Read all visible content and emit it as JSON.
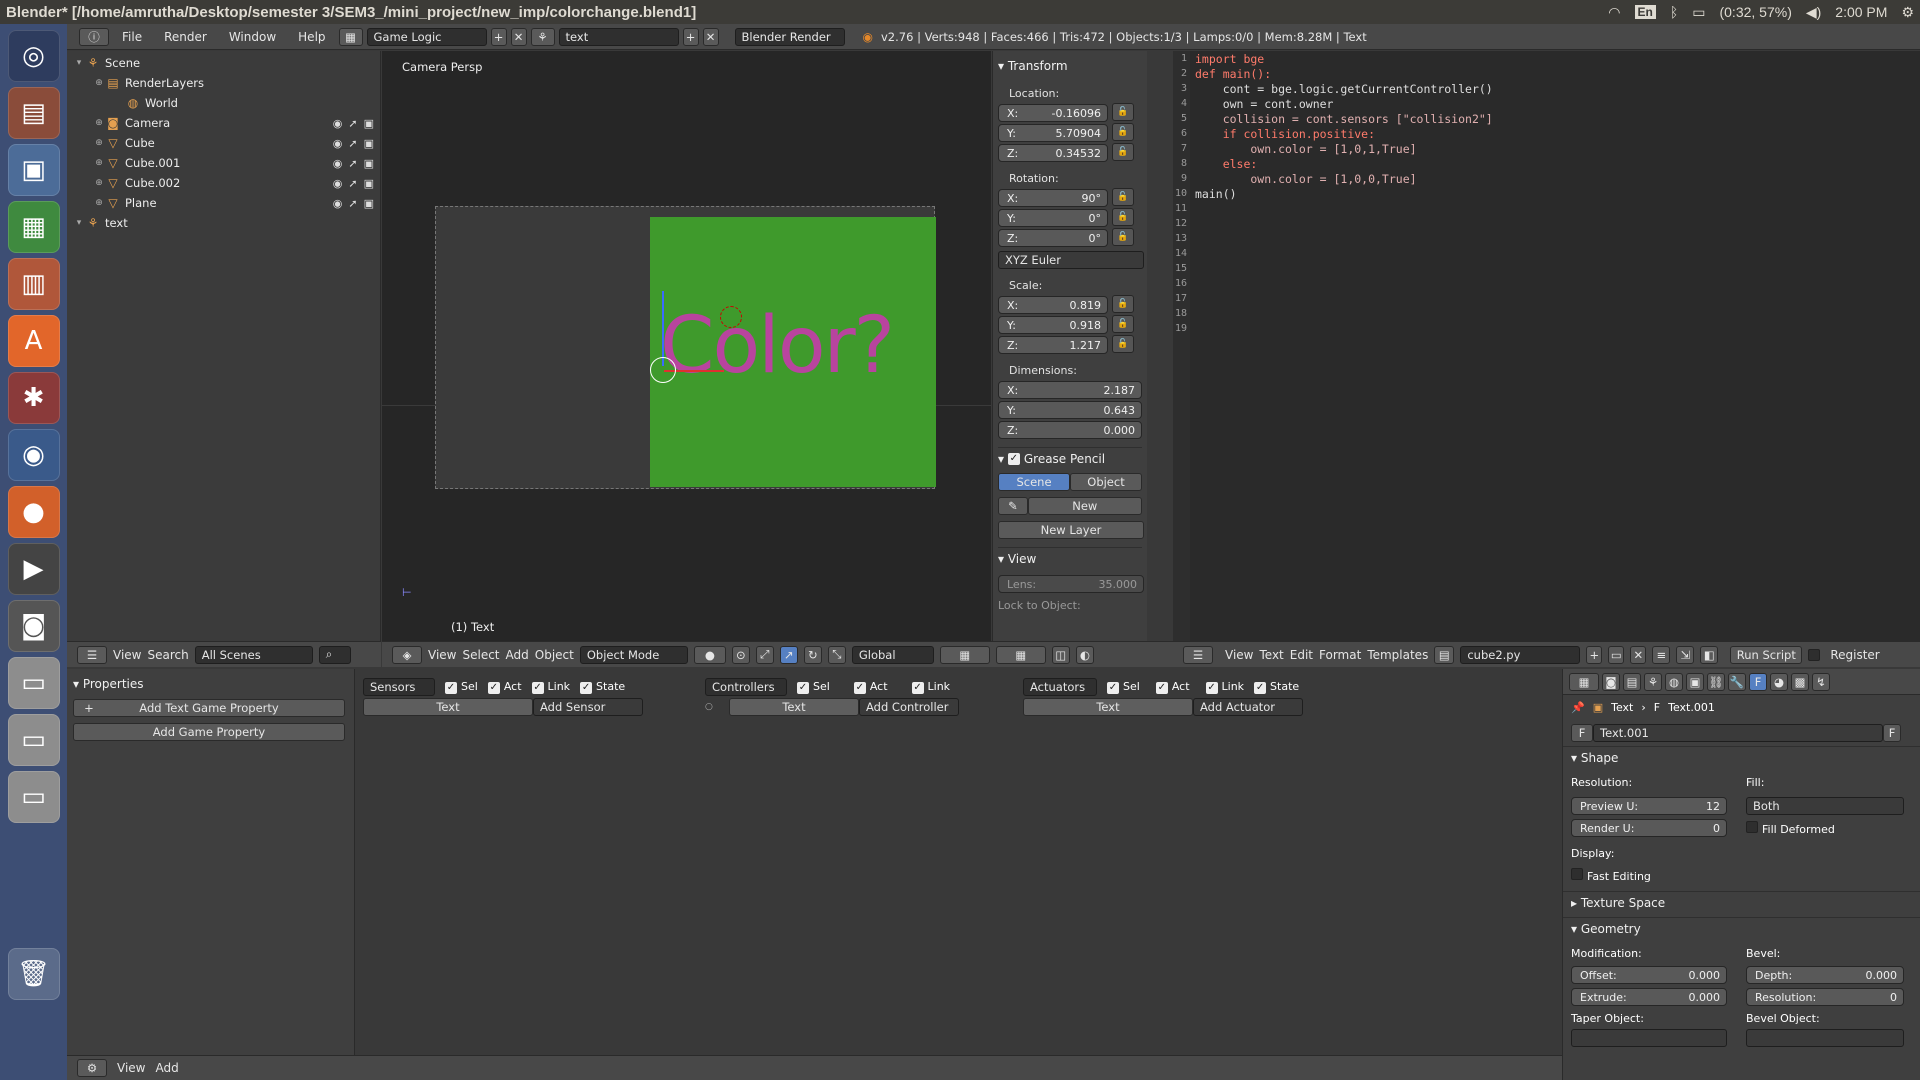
{
  "window": {
    "title": "Blender* [/home/amrutha/Desktop/semester 3/SEM3_/mini_project/new_imp/colorchange.blend1]"
  },
  "tray": {
    "lang": "En",
    "battery": "(0:32, 57%)",
    "time": "2:00 PM"
  },
  "menubar": {
    "items": [
      "File",
      "Render",
      "Window",
      "Help"
    ],
    "screen": "Game Logic",
    "scene": "text",
    "engine": "Blender Render",
    "stats": "v2.76 | Verts:948 | Faces:466 | Tris:472 | Objects:1/3 | Lamps:0/0 | Mem:8.28M | Text"
  },
  "outliner": {
    "items": [
      {
        "label": "Scene",
        "icon": "scene-icon"
      },
      {
        "label": "RenderLayers",
        "icon": "renderlayers-icon"
      },
      {
        "label": "World",
        "icon": "world-icon"
      },
      {
        "label": "Camera",
        "icon": "camera-icon"
      },
      {
        "label": "Cube",
        "icon": "mesh-icon"
      },
      {
        "label": "Cube.001",
        "icon": "mesh-icon"
      },
      {
        "label": "Cube.002",
        "icon": "mesh-icon"
      },
      {
        "label": "Plane",
        "icon": "mesh-icon"
      },
      {
        "label": "text",
        "icon": "scene-icon"
      }
    ],
    "header": {
      "view": "View",
      "search": "Search",
      "filter": "All Scenes"
    }
  },
  "viewport": {
    "label": "Camera Persp",
    "object_label": "(1) Text",
    "text_object": "Color?",
    "header": {
      "view": "View",
      "select": "Select",
      "add": "Add",
      "object": "Object",
      "mode": "Object Mode",
      "orientation": "Global"
    }
  },
  "transform": {
    "title": "Transform",
    "location_label": "Location:",
    "location": [
      "-0.16096",
      "5.70904",
      "0.34532"
    ],
    "rotation_label": "Rotation:",
    "rotation": [
      "90°",
      "0°",
      "0°"
    ],
    "rotation_mode": "XYZ Euler",
    "scale_label": "Scale:",
    "scale": [
      "0.819",
      "0.918",
      "1.217"
    ],
    "dimensions_label": "Dimensions:",
    "dimensions": [
      "2.187",
      "0.643",
      "0.000"
    ],
    "axes": [
      "X:",
      "Y:",
      "Z:"
    ]
  },
  "grease_pencil": {
    "title": "Grease Pencil",
    "scene": "Scene",
    "object": "Object",
    "new": "New",
    "new_layer": "New Layer"
  },
  "view_panel": {
    "title": "View",
    "lens_label": "Lens:",
    "lens": "35.000",
    "lock_label": "Lock to Object:"
  },
  "text_editor": {
    "lines": [
      "import bge",
      "",
      "",
      "def main():",
      "",
      "    cont = bge.logic.getCurrentController()",
      "    own = cont.owner",
      "",
      "    collision = cont.sensors [\"collision2\"]",
      "",
      "",
      "    if collision.positive:",
      "        own.color = [1,0,1,True]",
      "    else:",
      "        own.color = [1,0,0,True]",
      "",
      "",
      "main()",
      ""
    ],
    "header": {
      "view": "View",
      "text": "Text",
      "edit": "Edit",
      "format": "Format",
      "templates": "Templates",
      "file": "cube2.py",
      "run": "Run Script",
      "register": "Register"
    }
  },
  "logic": {
    "properties_title": "Properties",
    "add_text_prop": "Add Text Game Property",
    "add_prop": "Add Game Property",
    "sensors": "Sensors",
    "controllers": "Controllers",
    "actuators": "Actuators",
    "sel": "Sel",
    "act": "Act",
    "link": "Link",
    "state": "State",
    "object_name": "Text",
    "add_sensor": "Add Sensor",
    "add_controller": "Add Controller",
    "add_actuator": "Add Actuator",
    "bottom": {
      "view": "View",
      "add": "Add"
    }
  },
  "props": {
    "breadcrumb_obj": "Text",
    "breadcrumb_data": "Text.001",
    "datablock": "Text.001",
    "f_btn": "F",
    "shape_title": "Shape",
    "resolution_label": "Resolution:",
    "preview_u_label": "Preview U:",
    "preview_u": "12",
    "render_u_label": "Render U:",
    "render_u": "0",
    "fill_label": "Fill:",
    "fill": "Both",
    "fill_deformed": "Fill Deformed",
    "display_label": "Display:",
    "fast_editing": "Fast Editing",
    "texture_space": "Texture Space",
    "geometry_title": "Geometry",
    "modification_label": "Modification:",
    "offset_label": "Offset:",
    "offset": "0.000",
    "extrude_label": "Extrude:",
    "extrude": "0.000",
    "bevel_label": "Bevel:",
    "depth_label": "Depth:",
    "depth": "0.000",
    "bev_res_label": "Resolution:",
    "bev_res": "0",
    "taper_label": "Taper Object:",
    "bevel_obj_label": "Bevel Object:"
  },
  "colors": {
    "accent": "#5680c2",
    "green": "#3f9a2c",
    "text_magenta": "#b8449e",
    "launcher": "#3d4e74"
  }
}
